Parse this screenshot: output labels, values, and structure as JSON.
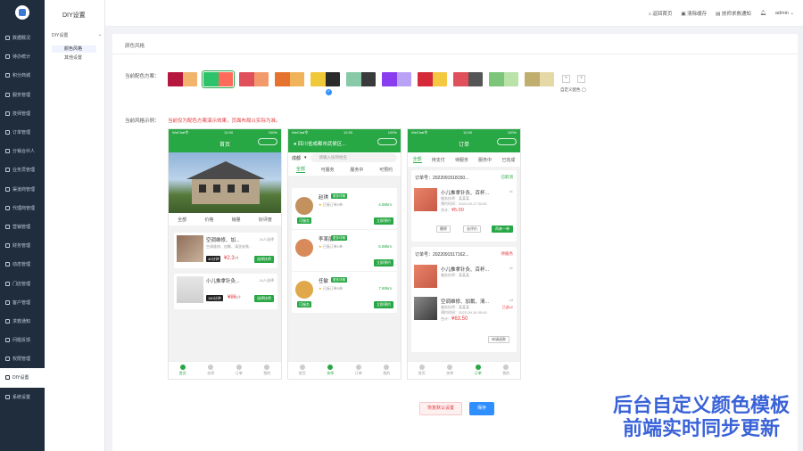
{
  "sidebar": {
    "items": [
      {
        "label": "数据概况",
        "active": false
      },
      {
        "label": "待办统计",
        "active": false
      },
      {
        "label": "积分商城",
        "active": false
      },
      {
        "label": "服务管理",
        "active": false
      },
      {
        "label": "技师管理",
        "active": false
      },
      {
        "label": "订单管理",
        "active": false
      },
      {
        "label": "分销合伙人",
        "active": false
      },
      {
        "label": "业务员管理",
        "active": false
      },
      {
        "label": "渠道商管理",
        "active": false
      },
      {
        "label": "代理商管理",
        "active": false
      },
      {
        "label": "营销管理",
        "active": false
      },
      {
        "label": "财务管理",
        "active": false
      },
      {
        "label": "动态管理",
        "active": false
      },
      {
        "label": "门店管理",
        "active": false
      },
      {
        "label": "客户管理",
        "active": false
      },
      {
        "label": "求救通知",
        "active": false
      },
      {
        "label": "问题反馈",
        "active": false
      },
      {
        "label": "权限管理",
        "active": false
      },
      {
        "label": "DIY设置",
        "active": true
      },
      {
        "label": "系统设置",
        "active": false
      }
    ]
  },
  "submenu": {
    "title": "DIY设置",
    "group": "DIY设置",
    "items": [
      "颜色风格",
      "其他设置"
    ]
  },
  "topbar": {
    "home": "返回首页",
    "cache": "清除缓存",
    "notify": "技师求救通知",
    "user": "admin"
  },
  "main": {
    "section": "颜色风格",
    "scheme_label": "当前配色方案：",
    "preview_label": "当前风格示例：",
    "note": "当前仅为配色方案演示效果，页面布局以实际为准。",
    "custom_label": "自定义配色",
    "swatches": [
      [
        "#b5173e",
        "#f2b36d"
      ],
      [
        "#2cc36b",
        "#ff6b5b"
      ],
      [
        "#e0505a",
        "#f29a6b"
      ],
      [
        "#e5722f",
        "#f0b35a"
      ],
      [
        "#f0c93a",
        "#2b2b2b"
      ],
      [
        "#88c9a8",
        "#3a3a3a"
      ],
      [
        "#8a3dee",
        "#b9a2f5"
      ],
      [
        "#d42a3a",
        "#f5c842"
      ],
      [
        "#e0505a",
        "#555555"
      ],
      [
        "#7cc57a",
        "#b9e3a9"
      ],
      [
        "#bfae6e",
        "#e6d9a8"
      ]
    ],
    "selected": 1,
    "reset_label": "恢复默认设置",
    "save_label": "保存"
  },
  "phone1": {
    "status": [
      "WeChat令",
      "12:00",
      "100%"
    ],
    "title": "首页",
    "filters": [
      "全部",
      "价格",
      "销量",
      "好评度"
    ],
    "items": [
      {
        "name": "空调维修、加...",
        "sales": "16人选择",
        "desc": "空调维修、加氟、清洗安装...",
        "tag": "40分钟",
        "price": "¥2.3",
        "unit": "/件",
        "btn": "选择技师"
      },
      {
        "name": "小儿推拿针灸...",
        "sales": "16人选择",
        "desc": "",
        "tag": "180分钟",
        "price": "¥86",
        "unit": "/件",
        "btn": "选择技师"
      }
    ],
    "tabs": [
      "首页",
      "技师",
      "订单",
      "我的"
    ]
  },
  "phone2": {
    "status": [
      "WeChat令",
      "12:00",
      "100%"
    ],
    "location": "四川省成都市武侯区...",
    "city": "成都",
    "search": "请输入技师姓名",
    "tabs": [
      "全部",
      "可服务",
      "服务中",
      "可预约"
    ],
    "workers": [
      {
        "name": "赵琪",
        "badge": "更多详情",
        "meta": "已接订单0单",
        "dist": "4.85km",
        "state": "可服务",
        "btn": "立即预约",
        "color": "#c2915e"
      },
      {
        "name": "李某朋",
        "badge": "更多详情",
        "meta": "已接订单1单",
        "dist": "5.88km",
        "state": "",
        "btn": "立即预约",
        "color": "#d98a5a"
      },
      {
        "name": "任敏",
        "badge": "更多详情",
        "meta": "已接订单0单",
        "dist": "7.80km",
        "state": "可服务",
        "btn": "立即预约",
        "color": "#e0a84a"
      }
    ],
    "bottom": [
      "首页",
      "技师",
      "订单",
      "我的"
    ]
  },
  "phone3": {
    "status": [
      "WeChat令",
      "12:00",
      "100%"
    ],
    "title": "订单",
    "tabs": [
      "全部",
      "待支付",
      "待服务",
      "服务中",
      "已完成"
    ],
    "orders": [
      {
        "no": "订单号：2022091518150...",
        "status": "已取消",
        "items": [
          {
            "name": "小儿推拿针灸、百杯...",
            "qty": "x1",
            "sub1": "服务技师：某某某",
            "sub2": "预约时间：2022-09-17 02:05",
            "total": "合计：",
            "price": "¥5.00"
          }
        ],
        "btns": [
          "删除",
          "去评价",
          "再来一单"
        ]
      },
      {
        "no": "订单号：2022091517162...",
        "status": "待服务",
        "items": [
          {
            "name": "小儿推拿针灸、百杯...",
            "qty": "x1",
            "sub1": "服务技师：某某某",
            "sub2": "",
            "total": "",
            "price": ""
          },
          {
            "name": "空调维修、加氟、清...",
            "qty": "x3",
            "sub1": "服务技师：某某某",
            "sub2": "预约时间：2022-09-16 00:00",
            "total": "合计：",
            "price": "¥63.50",
            "extra": "已退x2"
          }
        ],
        "btns": [
          "申请退款"
        ]
      }
    ],
    "bottom": [
      "首页",
      "技师",
      "订单",
      "我的"
    ]
  },
  "promo": {
    "line1": "后台自定义颜色模板",
    "line2": "前端实时同步更新"
  }
}
